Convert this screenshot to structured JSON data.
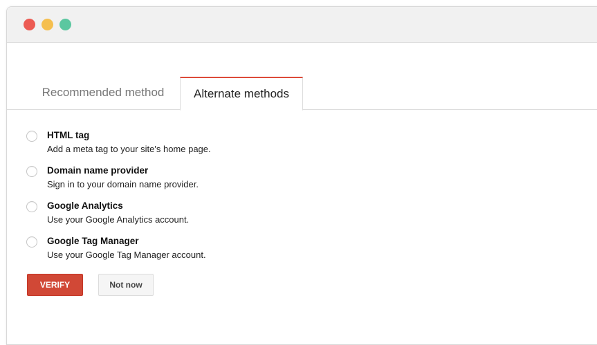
{
  "window": {
    "controls": [
      {
        "name": "close",
        "color": "#ec5b53"
      },
      {
        "name": "minimize",
        "color": "#f5bf4f"
      },
      {
        "name": "zoom",
        "color": "#5bc7a0"
      }
    ]
  },
  "tabs": [
    {
      "label": "Recommended method",
      "active": false
    },
    {
      "label": "Alternate methods",
      "active": true
    }
  ],
  "options": [
    {
      "title": "HTML tag",
      "description": "Add a meta tag to your site's home page.",
      "selected": false
    },
    {
      "title": "Domain name provider",
      "description": "Sign in to your domain name provider.",
      "selected": false
    },
    {
      "title": "Google Analytics",
      "description": "Use your Google Analytics account.",
      "selected": false
    },
    {
      "title": "Google Tag Manager",
      "description": "Use your Google Tag Manager account.",
      "selected": false
    }
  ],
  "buttons": {
    "verify_label": "VERIFY",
    "not_now_label": "Not now"
  },
  "colors": {
    "accent": "#dd4b39",
    "verify_bg": "#d14836"
  }
}
